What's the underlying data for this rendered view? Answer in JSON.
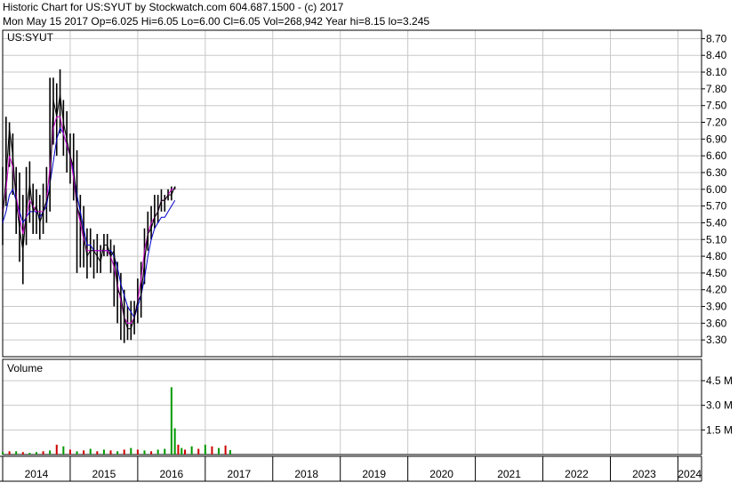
{
  "header": {
    "line1": "Historic Chart for US:SYUT by Stockwatch.com 604.687.1500 - (c) 2017",
    "line2": "Mon May 15 2017   Op=6.025  Hi=6.05  Lo=6.00  Cl=6.05  Vol=268,942  Year hi=8.15  lo=3.245"
  },
  "chart_data": {
    "type": "line",
    "symbol_label": "US:SYUT",
    "price_axis": {
      "ticks": [
        "8.70",
        "8.40",
        "8.10",
        "7.80",
        "7.50",
        "7.20",
        "6.90",
        "6.60",
        "6.30",
        "6.00",
        "5.70",
        "5.40",
        "5.10",
        "4.80",
        "4.50",
        "4.20",
        "3.90",
        "3.60",
        "3.30"
      ],
      "ylim": [
        3.0,
        8.85
      ]
    },
    "volume_axis": {
      "label": "Volume",
      "ticks": [
        "4.5 M",
        "3.0 M",
        "1.5 M"
      ],
      "ylim": [
        0,
        5.8
      ]
    },
    "x_axis": {
      "labels": [
        "2014",
        "2015",
        "2016",
        "2017",
        "2018",
        "2019",
        "2020",
        "2021",
        "2022",
        "2023",
        "2024"
      ],
      "xlim": [
        2014.0,
        2024.35
      ]
    },
    "colors": {
      "price": "#000000",
      "ma_short": "#cc00cc",
      "ma_long": "#0000cc",
      "vol_up": "#009900",
      "vol_down": "#cc0000",
      "grid": "#c8c8c8"
    },
    "price": {
      "x": [
        2014.0,
        2014.05,
        2014.1,
        2014.15,
        2014.2,
        2014.25,
        2014.3,
        2014.35,
        2014.4,
        2014.45,
        2014.5,
        2014.55,
        2014.6,
        2014.65,
        2014.7,
        2014.75,
        2014.8,
        2014.85,
        2014.9,
        2014.95,
        2015.0,
        2015.05,
        2015.1,
        2015.15,
        2015.2,
        2015.25,
        2015.3,
        2015.35,
        2015.4,
        2015.45,
        2015.5,
        2015.55,
        2015.6,
        2015.65,
        2015.7,
        2015.75,
        2015.8,
        2015.85,
        2015.9,
        2015.95,
        2016.0,
        2016.05,
        2016.1,
        2016.15,
        2016.2,
        2016.25,
        2016.3,
        2016.35,
        2016.4,
        2016.45,
        2016.5,
        2016.55,
        2016.6,
        2016.65,
        2016.7,
        2016.75,
        2016.8,
        2016.85,
        2016.9,
        2016.95,
        2017.0,
        2017.05,
        2017.1,
        2017.15,
        2017.2,
        2017.25,
        2017.3,
        2017.37
      ],
      "close": [
        5.5,
        6.2,
        7.1,
        6.6,
        5.8,
        5.3,
        4.9,
        5.6,
        6.1,
        5.6,
        5.7,
        5.4,
        5.6,
        5.8,
        6.0,
        7.6,
        7.3,
        7.7,
        7.2,
        6.9,
        6.6,
        6.4,
        5.7,
        5.5,
        5.2,
        4.8,
        4.9,
        4.9,
        4.8,
        4.7,
        5.0,
        5.0,
        4.8,
        4.9,
        4.2,
        4.1,
        3.7,
        3.5,
        3.5,
        3.7,
        4.0,
        4.1,
        4.7,
        5.2,
        5.3,
        5.5,
        5.6,
        5.8,
        5.8,
        5.9,
        5.9,
        6.05
      ],
      "high": [
        6.4,
        7.3,
        7.2,
        7.0,
        6.4,
        6.3,
        5.9,
        6.4,
        6.5,
        6.1,
        6.0,
        5.9,
        6.1,
        6.4,
        8.0,
        8.0,
        7.9,
        8.15,
        7.6,
        7.4,
        7.0,
        7.0,
        6.7,
        5.9,
        5.7,
        5.3,
        5.3,
        5.1,
        5.2,
        5.0,
        5.2,
        5.2,
        5.1,
        5.0,
        4.7,
        4.5,
        4.2,
        3.9,
        4.0,
        4.0,
        4.4,
        4.7,
        5.3,
        5.6,
        5.7,
        5.9,
        5.9,
        6.0,
        5.9,
        6.0,
        6.05,
        6.05
      ],
      "low": [
        5.0,
        5.7,
        6.4,
        5.9,
        5.2,
        4.7,
        4.3,
        5.0,
        5.4,
        5.2,
        5.2,
        5.1,
        5.2,
        5.4,
        5.6,
        6.8,
        6.6,
        7.0,
        6.6,
        6.3,
        6.1,
        5.8,
        4.5,
        4.6,
        4.6,
        4.4,
        4.6,
        4.4,
        4.5,
        4.5,
        4.8,
        4.8,
        4.5,
        3.9,
        3.6,
        3.3,
        3.245,
        3.3,
        3.3,
        3.4,
        3.6,
        3.7,
        4.3,
        4.9,
        5.1,
        5.3,
        5.4,
        5.6,
        5.6,
        5.8,
        5.8,
        6.0
      ],
      "ma_short": [
        5.6,
        6.0,
        6.6,
        6.4,
        5.9,
        5.5,
        5.2,
        5.5,
        5.8,
        5.7,
        5.6,
        5.6,
        5.6,
        5.8,
        6.4,
        7.1,
        7.3,
        7.3,
        7.0,
        6.8,
        6.6,
        6.2,
        5.7,
        5.4,
        5.1,
        4.9,
        4.9,
        4.9,
        4.9,
        4.9,
        4.9,
        4.9,
        4.8,
        4.6,
        4.3,
        4.0,
        3.7,
        3.6,
        3.6,
        3.7,
        4.0,
        4.4,
        4.9,
        5.2,
        5.4,
        5.5,
        5.6,
        5.8,
        5.8,
        5.9,
        6.0,
        6.0
      ],
      "ma_long": [
        5.4,
        5.6,
        5.9,
        6.0,
        5.8,
        5.6,
        5.4,
        5.5,
        5.6,
        5.6,
        5.6,
        5.5,
        5.6,
        5.7,
        6.1,
        6.5,
        6.9,
        7.1,
        7.0,
        6.8,
        6.6,
        6.3,
        5.9,
        5.6,
        5.3,
        5.0,
        5.0,
        4.9,
        4.9,
        4.9,
        4.9,
        4.9,
        4.9,
        4.8,
        4.6,
        4.3,
        4.1,
        3.9,
        3.8,
        3.7,
        3.9,
        4.1,
        4.4,
        4.8,
        5.1,
        5.3,
        5.4,
        5.5,
        5.5,
        5.6,
        5.7,
        5.8
      ]
    },
    "volume": {
      "x": [
        2014.0,
        2014.1,
        2014.2,
        2014.3,
        2014.4,
        2014.5,
        2014.6,
        2014.7,
        2014.8,
        2014.9,
        2015.0,
        2015.1,
        2015.2,
        2015.3,
        2015.4,
        2015.5,
        2015.6,
        2015.7,
        2015.8,
        2015.9,
        2016.0,
        2016.1,
        2016.2,
        2016.3,
        2016.4,
        2016.5,
        2016.55,
        2016.6,
        2016.65,
        2016.7,
        2016.8,
        2016.9,
        2017.0,
        2017.1,
        2017.2,
        2017.3,
        2017.37
      ],
      "values": [
        0.15,
        0.2,
        0.2,
        0.15,
        0.1,
        0.15,
        0.2,
        0.25,
        0.6,
        0.5,
        0.3,
        0.2,
        0.25,
        0.35,
        0.2,
        0.3,
        0.25,
        0.2,
        0.3,
        0.4,
        0.3,
        0.25,
        0.2,
        0.3,
        0.35,
        4.1,
        1.6,
        0.6,
        0.4,
        0.3,
        0.5,
        0.35,
        0.6,
        0.5,
        0.4,
        0.55,
        0.27
      ],
      "direction": [
        "up",
        "down",
        "up",
        "down",
        "up",
        "up",
        "down",
        "up",
        "down",
        "up",
        "down",
        "up",
        "down",
        "up",
        "down",
        "up",
        "down",
        "up",
        "down",
        "up",
        "down",
        "up",
        "down",
        "up",
        "up",
        "up",
        "up",
        "down",
        "up",
        "down",
        "up",
        "down",
        "up",
        "down",
        "up",
        "down",
        "up"
      ]
    }
  }
}
